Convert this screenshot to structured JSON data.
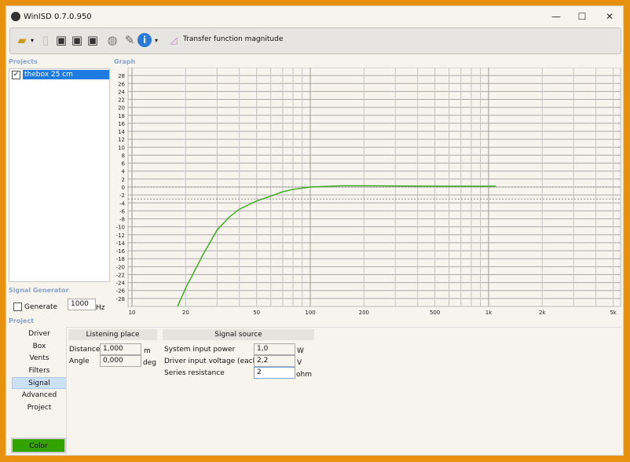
{
  "window": {
    "title": "WinISD 0.7.0.950",
    "minimize": "—",
    "maximize": "☐",
    "close": "✕"
  },
  "toolbar": {
    "icons": [
      "open-folder-icon",
      "new-project-icon",
      "save-icon",
      "save-as-icon",
      "save-all-icon",
      "driver-editor-icon",
      "tools-icon",
      "info-icon"
    ],
    "graph_selector": "Transfer function magnitude"
  },
  "projects": {
    "label": "Projects",
    "items": [
      {
        "name": "thebox 25 cm",
        "checked": true
      }
    ]
  },
  "graph": {
    "label": "Graph"
  },
  "signal_generator": {
    "label": "Signal Generator",
    "generate_label": "Generate",
    "generate_checked": false,
    "frequency": "1000",
    "unit": "Hz"
  },
  "project": {
    "label": "Project",
    "nav": [
      "Driver",
      "Box",
      "Vents",
      "Filters",
      "Signal",
      "Advanced",
      "Project"
    ],
    "selected": "Signal",
    "color_button": "Color",
    "color": "#33a300"
  },
  "listening_place": {
    "title": "Listening place",
    "distance_label": "Distance",
    "distance": "1,000",
    "distance_unit": "m",
    "angle_label": "Angle",
    "angle": "0,000",
    "angle_unit": "deg"
  },
  "signal_source": {
    "title": "Signal source",
    "power_label": "System input power",
    "power": "1,0",
    "power_unit": "W",
    "voltage_label": "Driver input voltage (each)",
    "voltage": "2,2",
    "voltage_unit": "V",
    "resistance_label": "Series resistance",
    "resistance": "2",
    "resistance_unit": "ohm"
  },
  "chart_data": {
    "type": "line",
    "xscale": "log",
    "xlim": [
      9.5,
      5500
    ],
    "ylim": [
      -30,
      30
    ],
    "grid": true,
    "xticks": [
      "10",
      "20",
      "50",
      "100",
      "200",
      "500",
      "1k",
      "2k",
      "5k"
    ],
    "xtick_values": [
      10,
      20,
      50,
      100,
      200,
      500,
      1000,
      2000,
      5000
    ],
    "yticks": [
      28,
      26,
      24,
      22,
      20,
      18,
      16,
      14,
      12,
      10,
      8,
      6,
      4,
      2,
      0,
      -2,
      -4,
      -6,
      -8,
      -10,
      -12,
      -14,
      -16,
      -18,
      -20,
      -22,
      -24,
      -26,
      -28
    ],
    "reference_lines": [
      0,
      -3
    ],
    "series": [
      {
        "color": "#3aa81a",
        "x": [
          18,
          20,
          25,
          30,
          35,
          40,
          50,
          60,
          70,
          80,
          100,
          150,
          200,
          500,
          1100
        ],
        "y": [
          -30,
          -25.4,
          -17,
          -10.8,
          -7.6,
          -5.6,
          -3.5,
          -2.3,
          -1.2,
          -0.6,
          0,
          0.3,
          0.3,
          0.2,
          0.2
        ]
      }
    ]
  }
}
